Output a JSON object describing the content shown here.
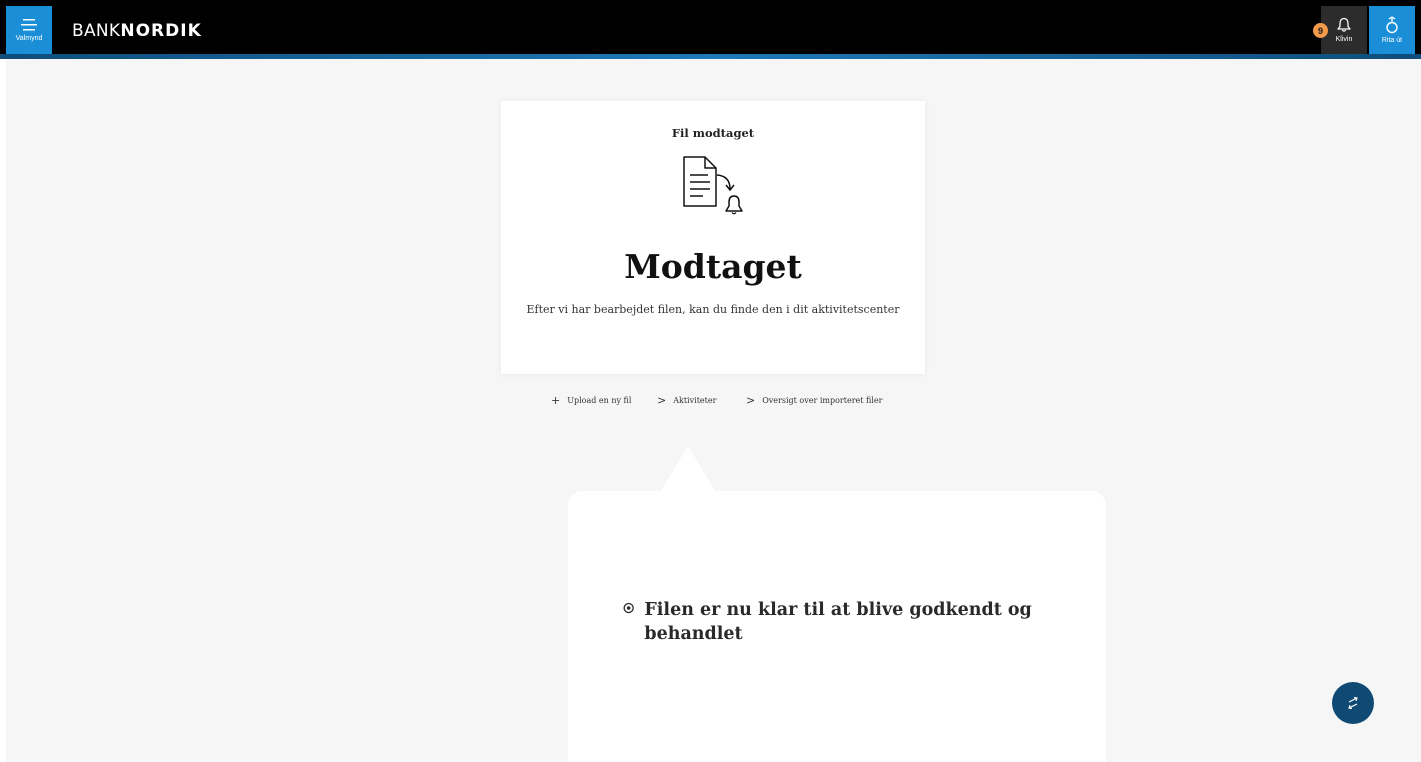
{
  "header": {
    "menu_label": "Valmynd",
    "logo_bank": "BANK",
    "logo_nordik": "NORDIK",
    "notifications_count": "9",
    "notifications_label": "Klivin",
    "logout_label": "Rita út",
    "accent_color": "#1a8fd8"
  },
  "card": {
    "title": "Fil modtaget",
    "icon": "document-received-icon",
    "heading": "Modtaget",
    "description": "Efter vi har bearbejdet filen, kan du finde den i dit aktivitetscenter"
  },
  "links": [
    {
      "icon": "+",
      "label": "Upload en ny fil"
    },
    {
      "icon": ">",
      "label": "Aktiviteter"
    },
    {
      "icon": ">",
      "label": "Oversigt over importeret filer"
    }
  ],
  "tooltip": {
    "text": "Filen er nu klar til at blive godkendt og behandlet"
  },
  "fab": {
    "icon": "swap-arrows-icon",
    "color": "#0e4a73"
  }
}
